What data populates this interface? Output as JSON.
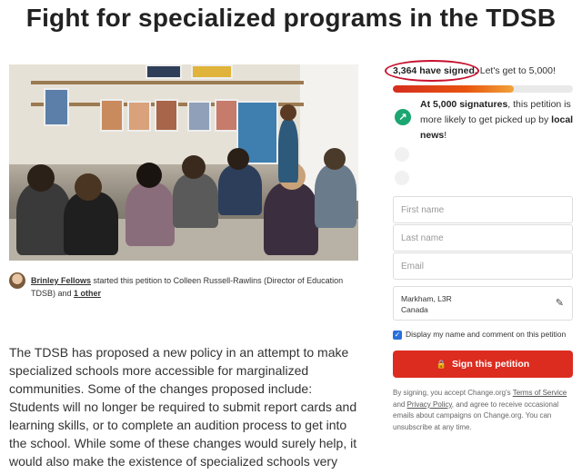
{
  "page": {
    "title": "Fight for specialized programs in the TDSB"
  },
  "starter": {
    "author": "Brinley Fellows",
    "text_mid": " started this petition to Colleen Russell-Rawlins (Director of Education TDSB) and ",
    "other": "1 other"
  },
  "story": "The TDSB has proposed a new policy in an attempt to make specialized schools more accessible for marginalized communities. Some of the changes proposed include: Students will no longer be required to submit report cards and learning skills, or to complete an audition process to get into the school. While some of these changes would surely help, it would also make the existence of specialized schools very difficult.",
  "signatures": {
    "count_text": "3,364 have signed.",
    "goal_text": " Let's get to 5,000!",
    "progress_fraction": 0.67
  },
  "promo": {
    "bold1": "At 5,000 signatures",
    "text": ", this petition is more likely to get picked up by ",
    "bold2": "local news",
    "end": "!"
  },
  "form": {
    "first_name_placeholder": "First name",
    "last_name_placeholder": "Last name",
    "email_placeholder": "Email",
    "location_line1": "Markham, L3R",
    "location_line2": "Canada",
    "display_checkbox_label": "Display my name and comment on this petition",
    "sign_button_label": "Sign this petition"
  },
  "legal": {
    "part1": "By signing, you accept Change.org's ",
    "terms": "Terms of Service",
    "part2": " and ",
    "privacy": "Privacy Policy",
    "part3": ", and agree to receive occasional emails about campaigns on Change.org. You can unsubscribe at any time."
  },
  "colors": {
    "accent": "#dc2c20",
    "success": "#1ba672",
    "checkbox": "#2a6fdb"
  },
  "icons": [
    "trending-up-icon",
    "edit-pencil-icon",
    "lock-icon",
    "checkbox-checked-icon"
  ]
}
